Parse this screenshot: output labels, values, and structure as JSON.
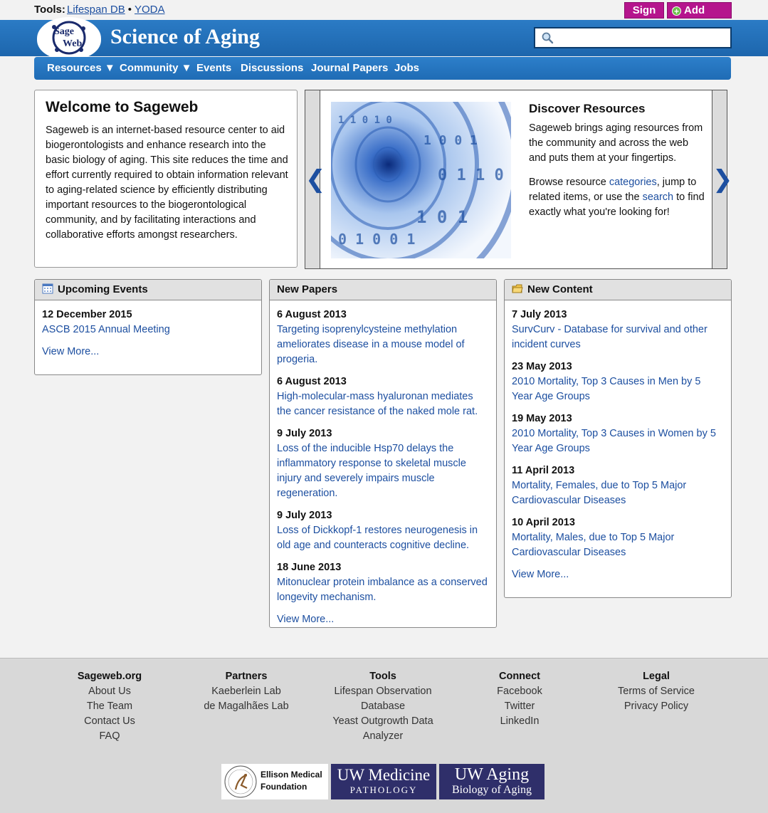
{
  "toolbar": {
    "tools_label": "Tools:",
    "links": [
      "Lifespan DB",
      "YODA"
    ],
    "separator": "•",
    "signin": "Sign In",
    "addpost": "Add Post"
  },
  "header": {
    "title": "Science of Aging",
    "search_placeholder": "",
    "logo_text": "SageWeb"
  },
  "nav": {
    "items": [
      "Resources ▼",
      "Community ▼",
      "Events",
      "Discussions",
      "Journal Papers",
      "Jobs"
    ]
  },
  "welcome": {
    "title": "Welcome to Sageweb",
    "body": "Sageweb is an internet-based resource center to aid biogerontologists and enhance research into the basic biology of aging. This site reduces the time and effort currently required to obtain information relevant to aging-related science by efficiently distributing important resources to the biogerontological community, and by facilitating interactions and collaborative efforts amongst researchers."
  },
  "carousel": {
    "prev": "❮",
    "next": "❯",
    "title": "Discover Resources",
    "text1": "Sageweb brings aging resources from the community and across the web and puts them at your fingertips.",
    "text2_a": "Browse resource ",
    "text2_link1": "categories",
    "text2_b": ", jump to related items, or use the ",
    "text2_link2": "search",
    "text2_c": " to find exactly what you're looking for!"
  },
  "events": {
    "title": "Upcoming Events",
    "items": [
      {
        "date": "12 December 2015",
        "title": "ASCB 2015 Annual Meeting"
      }
    ],
    "view_more": "View More..."
  },
  "papers": {
    "title": "New Papers",
    "items": [
      {
        "date": "6 August 2013",
        "title": "Targeting isoprenylcysteine methylation ameliorates disease in a mouse model of progeria."
      },
      {
        "date": "6 August 2013",
        "title": "High-molecular-mass hyaluronan mediates the cancer resistance of the naked mole rat."
      },
      {
        "date": "9 July 2013",
        "title": "Loss of the inducible Hsp70 delays the inflammatory response to skeletal muscle injury and severely impairs muscle regeneration."
      },
      {
        "date": "9 July 2013",
        "title": "Loss of Dickkopf-1 restores neurogenesis in old age and counteracts cognitive decline."
      },
      {
        "date": "18 June 2013",
        "title": "Mitonuclear protein imbalance as a conserved longevity mechanism."
      }
    ],
    "view_more": "View More..."
  },
  "content": {
    "title": "New Content",
    "items": [
      {
        "date": "7 July 2013",
        "title": "SurvCurv - Database for survival and other incident curves"
      },
      {
        "date": "23 May 2013",
        "title": "2010 Mortality, Top 3 Causes in Men by 5 Year Age Groups"
      },
      {
        "date": "19 May 2013",
        "title": "2010 Mortality, Top 3 Causes in Women by 5 Year Age Groups"
      },
      {
        "date": "11 April 2013",
        "title": "Mortality, Females, due to Top 5 Major Cardiovascular Diseases"
      },
      {
        "date": "10 April 2013",
        "title": "Mortality, Males, due to Top 5 Major Cardiovascular Diseases"
      }
    ],
    "view_more": "View More..."
  },
  "footer": {
    "columns": [
      {
        "title": "Sageweb.org",
        "links": [
          "About Us",
          "The Team",
          "Contact Us",
          "FAQ"
        ]
      },
      {
        "title": "Partners",
        "links": [
          "Kaeberlein Lab",
          "de Magalhães Lab"
        ]
      },
      {
        "title": "Tools",
        "links": [
          "Lifespan Observation Database",
          "Yeast Outgrowth Data Analyzer"
        ]
      },
      {
        "title": "Connect",
        "links": [
          "Facebook",
          "Twitter",
          "LinkedIn"
        ]
      },
      {
        "title": "Legal",
        "links": [
          "Terms of Service",
          "Privacy Policy"
        ]
      }
    ],
    "sponsors": {
      "ellison_line1": "Ellison Medical",
      "ellison_line2": "Foundation",
      "uwmed_line1": "UW Medicine",
      "uwmed_line2": "PATHOLOGY",
      "uwaging_line1": "UW Aging",
      "uwaging_line2": "Biology of Aging"
    }
  },
  "colors": {
    "brand_blue": "#1f6cb5",
    "link": "#1d4fa0",
    "magenta_button": "#b5158d"
  }
}
